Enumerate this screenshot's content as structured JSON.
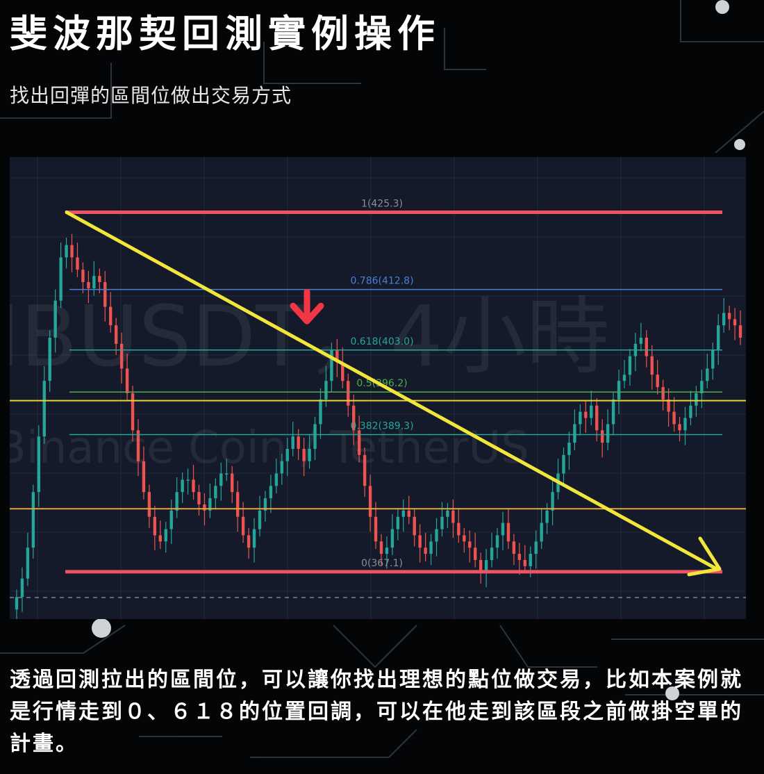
{
  "title": "斐波那契回測實例操作",
  "subtitle": "找出回彈的區間位做出交易方式",
  "caption": "透過回測拉出的區間位，可以讓你找出理想的點位做交易，比如本案例就是行情走到０、６１８的位置回調，可以在他走到該區段之前做掛空單的計畫。",
  "chart_data": {
    "type": "candlestick",
    "watermark_symbol": "IBUSDT，4小時",
    "watermark_name": "Binance Coin / TetherUS",
    "ylim": [
      360,
      432
    ],
    "fib_levels": [
      {
        "label": "1(425.3)",
        "ratio": 1,
        "price": 425.3,
        "color": "#f05266"
      },
      {
        "label": "0.786(412.8)",
        "ratio": 0.786,
        "price": 412.8,
        "color": "#4a7fd6"
      },
      {
        "label": "0.618(403.0)",
        "ratio": 0.618,
        "price": 403.0,
        "color": "#26a69a"
      },
      {
        "label": "0.5(396.2)",
        "ratio": 0.5,
        "price": 396.2,
        "color": "#4caf50"
      },
      {
        "label": "0.382(389.3)",
        "ratio": 0.382,
        "price": 389.3,
        "color": "#26a69a"
      },
      {
        "label": "0(367.1)",
        "ratio": 0,
        "price": 367.1,
        "color": "#f05266"
      }
    ],
    "horizontal_lines": [
      {
        "price": 394.8,
        "color": "#e8d43a"
      },
      {
        "price": 377.3,
        "color": "#e8a53a"
      }
    ],
    "trend_arrow": {
      "from_price": 425.3,
      "to_price": 367.1,
      "color": "#f2e63a"
    },
    "marker_arrow": {
      "price": 407,
      "color": "#f23645",
      "direction": "down"
    },
    "closes": [
      363,
      366,
      371,
      380,
      389,
      398,
      405,
      411,
      418,
      420,
      418,
      416,
      414,
      413,
      415,
      414,
      410,
      407,
      404,
      400,
      396,
      390,
      385,
      380,
      376,
      373,
      372,
      374,
      377,
      380,
      382,
      382,
      380,
      378,
      377,
      379,
      381,
      383,
      383,
      380,
      376,
      373,
      371,
      374,
      377,
      379,
      381,
      383,
      385,
      387,
      389,
      387,
      385,
      387,
      391,
      395,
      398,
      403,
      401,
      398,
      394,
      390,
      386,
      381,
      376,
      372,
      370,
      371,
      374,
      376,
      377,
      376,
      373,
      371,
      370,
      372,
      374,
      376,
      377,
      375,
      373,
      372,
      371,
      369,
      367,
      369,
      371,
      373,
      375,
      372,
      370,
      369,
      368,
      370,
      372,
      375,
      377,
      380,
      383,
      386,
      388,
      391,
      393,
      392,
      394,
      390,
      388,
      391,
      395,
      398,
      399,
      402,
      404,
      405,
      402,
      399,
      397,
      395,
      393,
      391,
      390,
      392,
      394,
      396,
      398,
      400,
      403,
      407,
      409,
      408,
      407,
      405
    ]
  }
}
